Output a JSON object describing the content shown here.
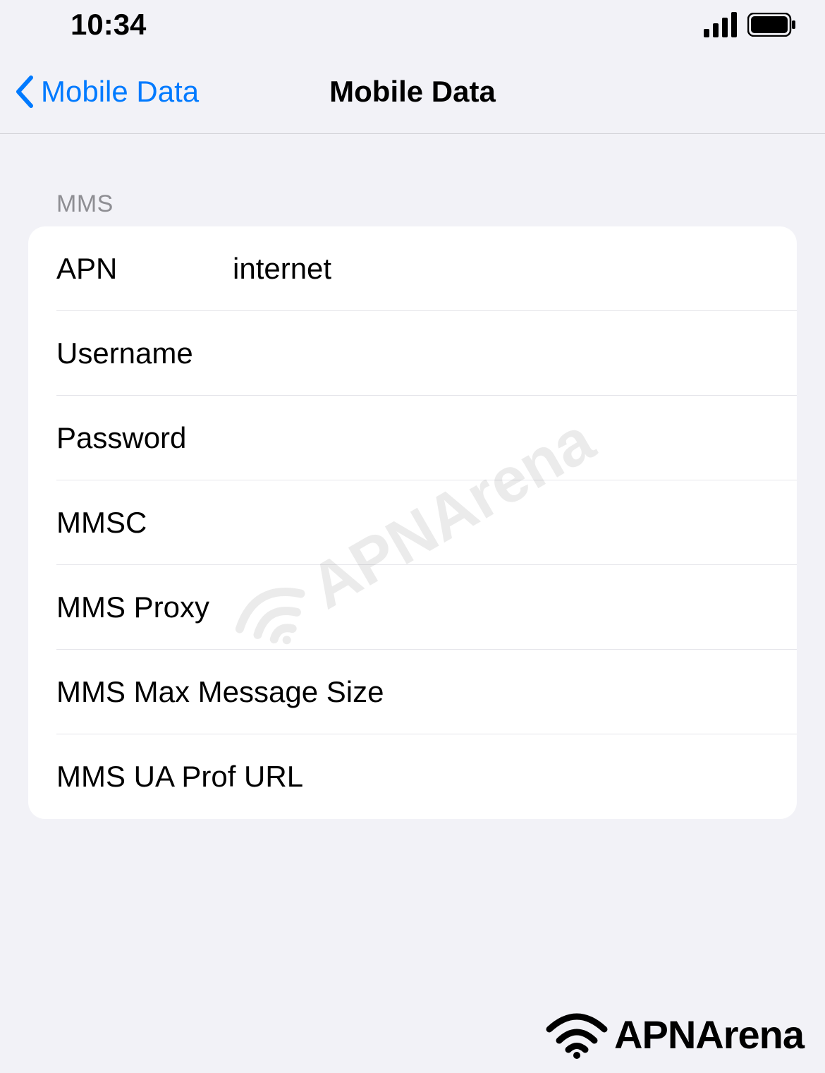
{
  "statusBar": {
    "time": "10:34"
  },
  "navBar": {
    "backLabel": "Mobile Data",
    "title": "Mobile Data"
  },
  "section": {
    "header": "MMS",
    "rows": [
      {
        "label": "APN",
        "value": "internet"
      },
      {
        "label": "Username",
        "value": ""
      },
      {
        "label": "Password",
        "value": ""
      },
      {
        "label": "MMSC",
        "value": ""
      },
      {
        "label": "MMS Proxy",
        "value": ""
      },
      {
        "label": "MMS Max Message Size",
        "value": ""
      },
      {
        "label": "MMS UA Prof URL",
        "value": ""
      }
    ]
  },
  "watermark": {
    "text": "APNArena"
  },
  "footer": {
    "text": "APNArena"
  }
}
